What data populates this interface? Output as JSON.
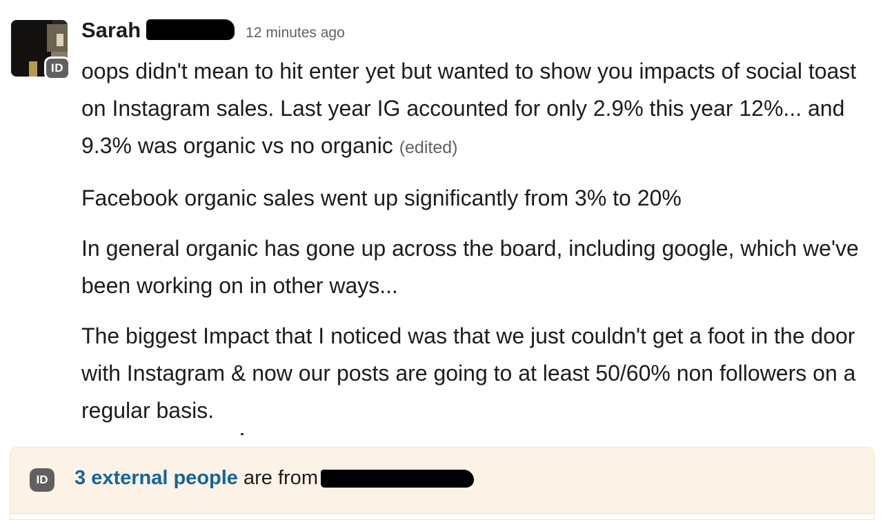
{
  "message": {
    "sender_first_name": "Sarah",
    "timestamp": "12 minutes ago",
    "badge": "ID",
    "paragraphs": [
      "oops didn't mean to hit enter yet but wanted to show you impacts of social toast on Instagram sales. Last year IG accounted for only 2.9% this year 12%... and 9.3% was organic vs no organic",
      "Facebook organic sales went up significantly from 3% to 20%",
      "In general organic has gone up across the board, including google, which we've been working on in other ways...",
      "The biggest Impact that I noticed was that we just couldn't get a foot in the door with Instagram & now our posts are going to at least 50/60% non followers on a regular basis."
    ],
    "edited_label": "(edited)"
  },
  "notice": {
    "badge": "ID",
    "link_text": "3 external people",
    "rest_text": "are from"
  },
  "colors": {
    "link": "#1264a3",
    "notice_bg": "#fcf3e6",
    "badge_bg": "#616061",
    "muted_text": "#616061"
  },
  "icons": {
    "external_badge": "id-badge-icon",
    "avatar": "user-avatar"
  }
}
